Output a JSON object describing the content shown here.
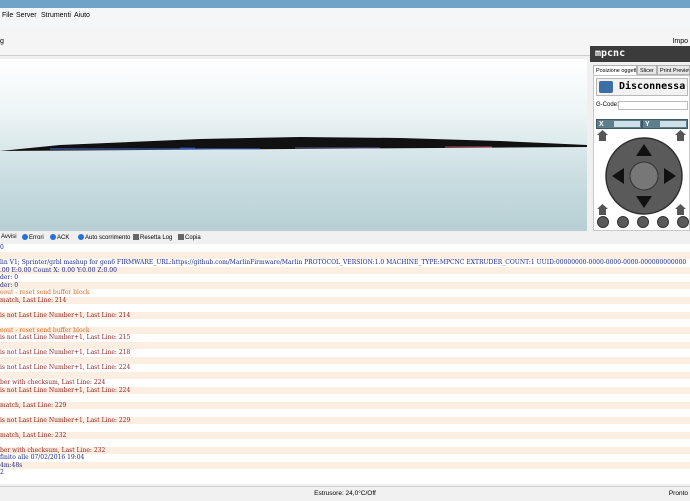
{
  "menu": {
    "items": [
      "File",
      "Server",
      "Strumenti",
      "Aiuto"
    ]
  },
  "toolbar": {
    "left_label": "g",
    "right_label": "Impo"
  },
  "right_panel": {
    "title": "mpcnc",
    "tabs": [
      "Posizione oggetto",
      "Slicer",
      "Print Preview"
    ],
    "disconnect_label": "Disconnessa",
    "gcode_label": "G-Code:",
    "gcode_value": "",
    "x_label": "X",
    "y_label": "Y"
  },
  "log_toolbar": {
    "items": [
      "Avvisi",
      "Errori",
      "ACK",
      "Auto scorrimento",
      "Resetta Log",
      "Copia"
    ]
  },
  "log_lines": [
    {
      "text": "0",
      "style": "blue",
      "alt": false
    },
    {
      "text": "",
      "style": "blue",
      "alt": true
    },
    {
      "text": "lin V1; Sprinter/grbl mashup for gen6 FIRMWARE_URL:https://github.com/MarlinFirmware/Marlin PROTOCOL_VERSION:1.0 MACHINE_TYPE:MPCNC EXTRUDER_COUNT:1 UUID:00000000-0000-0000-0000-000000000000",
      "style": "blue",
      "alt": false
    },
    {
      "text": ".00 E:0.00 Count X: 0.00 Y:0.00 Z:0.00",
      "style": "blue",
      "alt": true
    },
    {
      "text": "der: 0",
      "style": "blue",
      "alt": false
    },
    {
      "text": "der: 0",
      "style": "blue",
      "alt": true
    },
    {
      "text": "eout - reset send buffer block",
      "style": "orange",
      "alt": false
    },
    {
      "text": "match, Last Line: 214",
      "style": "red",
      "alt": true
    },
    {
      "text": "",
      "style": "red",
      "alt": false
    },
    {
      "text": " is not Last Line Number+1, Last Line: 214",
      "style": "red",
      "alt": true
    },
    {
      "text": "",
      "style": "red",
      "alt": false
    },
    {
      "text": "eout - reset send buffer block",
      "style": "orange",
      "alt": true
    },
    {
      "text": " is not Last Line Number+1, Last Line: 215",
      "style": "red",
      "alt": false
    },
    {
      "text": "",
      "style": "red",
      "alt": true
    },
    {
      "text": " is not Last Line Number+1, Last Line: 218",
      "style": "red",
      "alt": false
    },
    {
      "text": "",
      "style": "red",
      "alt": true
    },
    {
      "text": " is not Last Line Number+1, Last Line: 224",
      "style": "red",
      "alt": false
    },
    {
      "text": "",
      "style": "red",
      "alt": true
    },
    {
      "text": "ber with checksum, Last Line: 224",
      "style": "red",
      "alt": false
    },
    {
      "text": " is not Last Line Number+1, Last Line: 224",
      "style": "red",
      "alt": true
    },
    {
      "text": "",
      "style": "red",
      "alt": false
    },
    {
      "text": "match, Last Line: 229",
      "style": "red",
      "alt": true
    },
    {
      "text": "",
      "style": "red",
      "alt": false
    },
    {
      "text": " is not Last Line Number+1, Last Line: 229",
      "style": "red",
      "alt": true
    },
    {
      "text": "",
      "style": "red",
      "alt": false
    },
    {
      "text": "match, Last Line: 232",
      "style": "red",
      "alt": true
    },
    {
      "text": "",
      "style": "red",
      "alt": false
    },
    {
      "text": "ber with checksum, Last Line: 232",
      "style": "red",
      "alt": true
    },
    {
      "text": "finito alle 07/02/2016 19:04",
      "style": "blue",
      "alt": false
    },
    {
      "text": "4m:48s",
      "style": "blue",
      "alt": true
    },
    {
      "text": "2",
      "style": "blue",
      "alt": false
    }
  ],
  "status": {
    "center": "Estrusore: 24,0°C/Off",
    "right": "Pronto"
  }
}
